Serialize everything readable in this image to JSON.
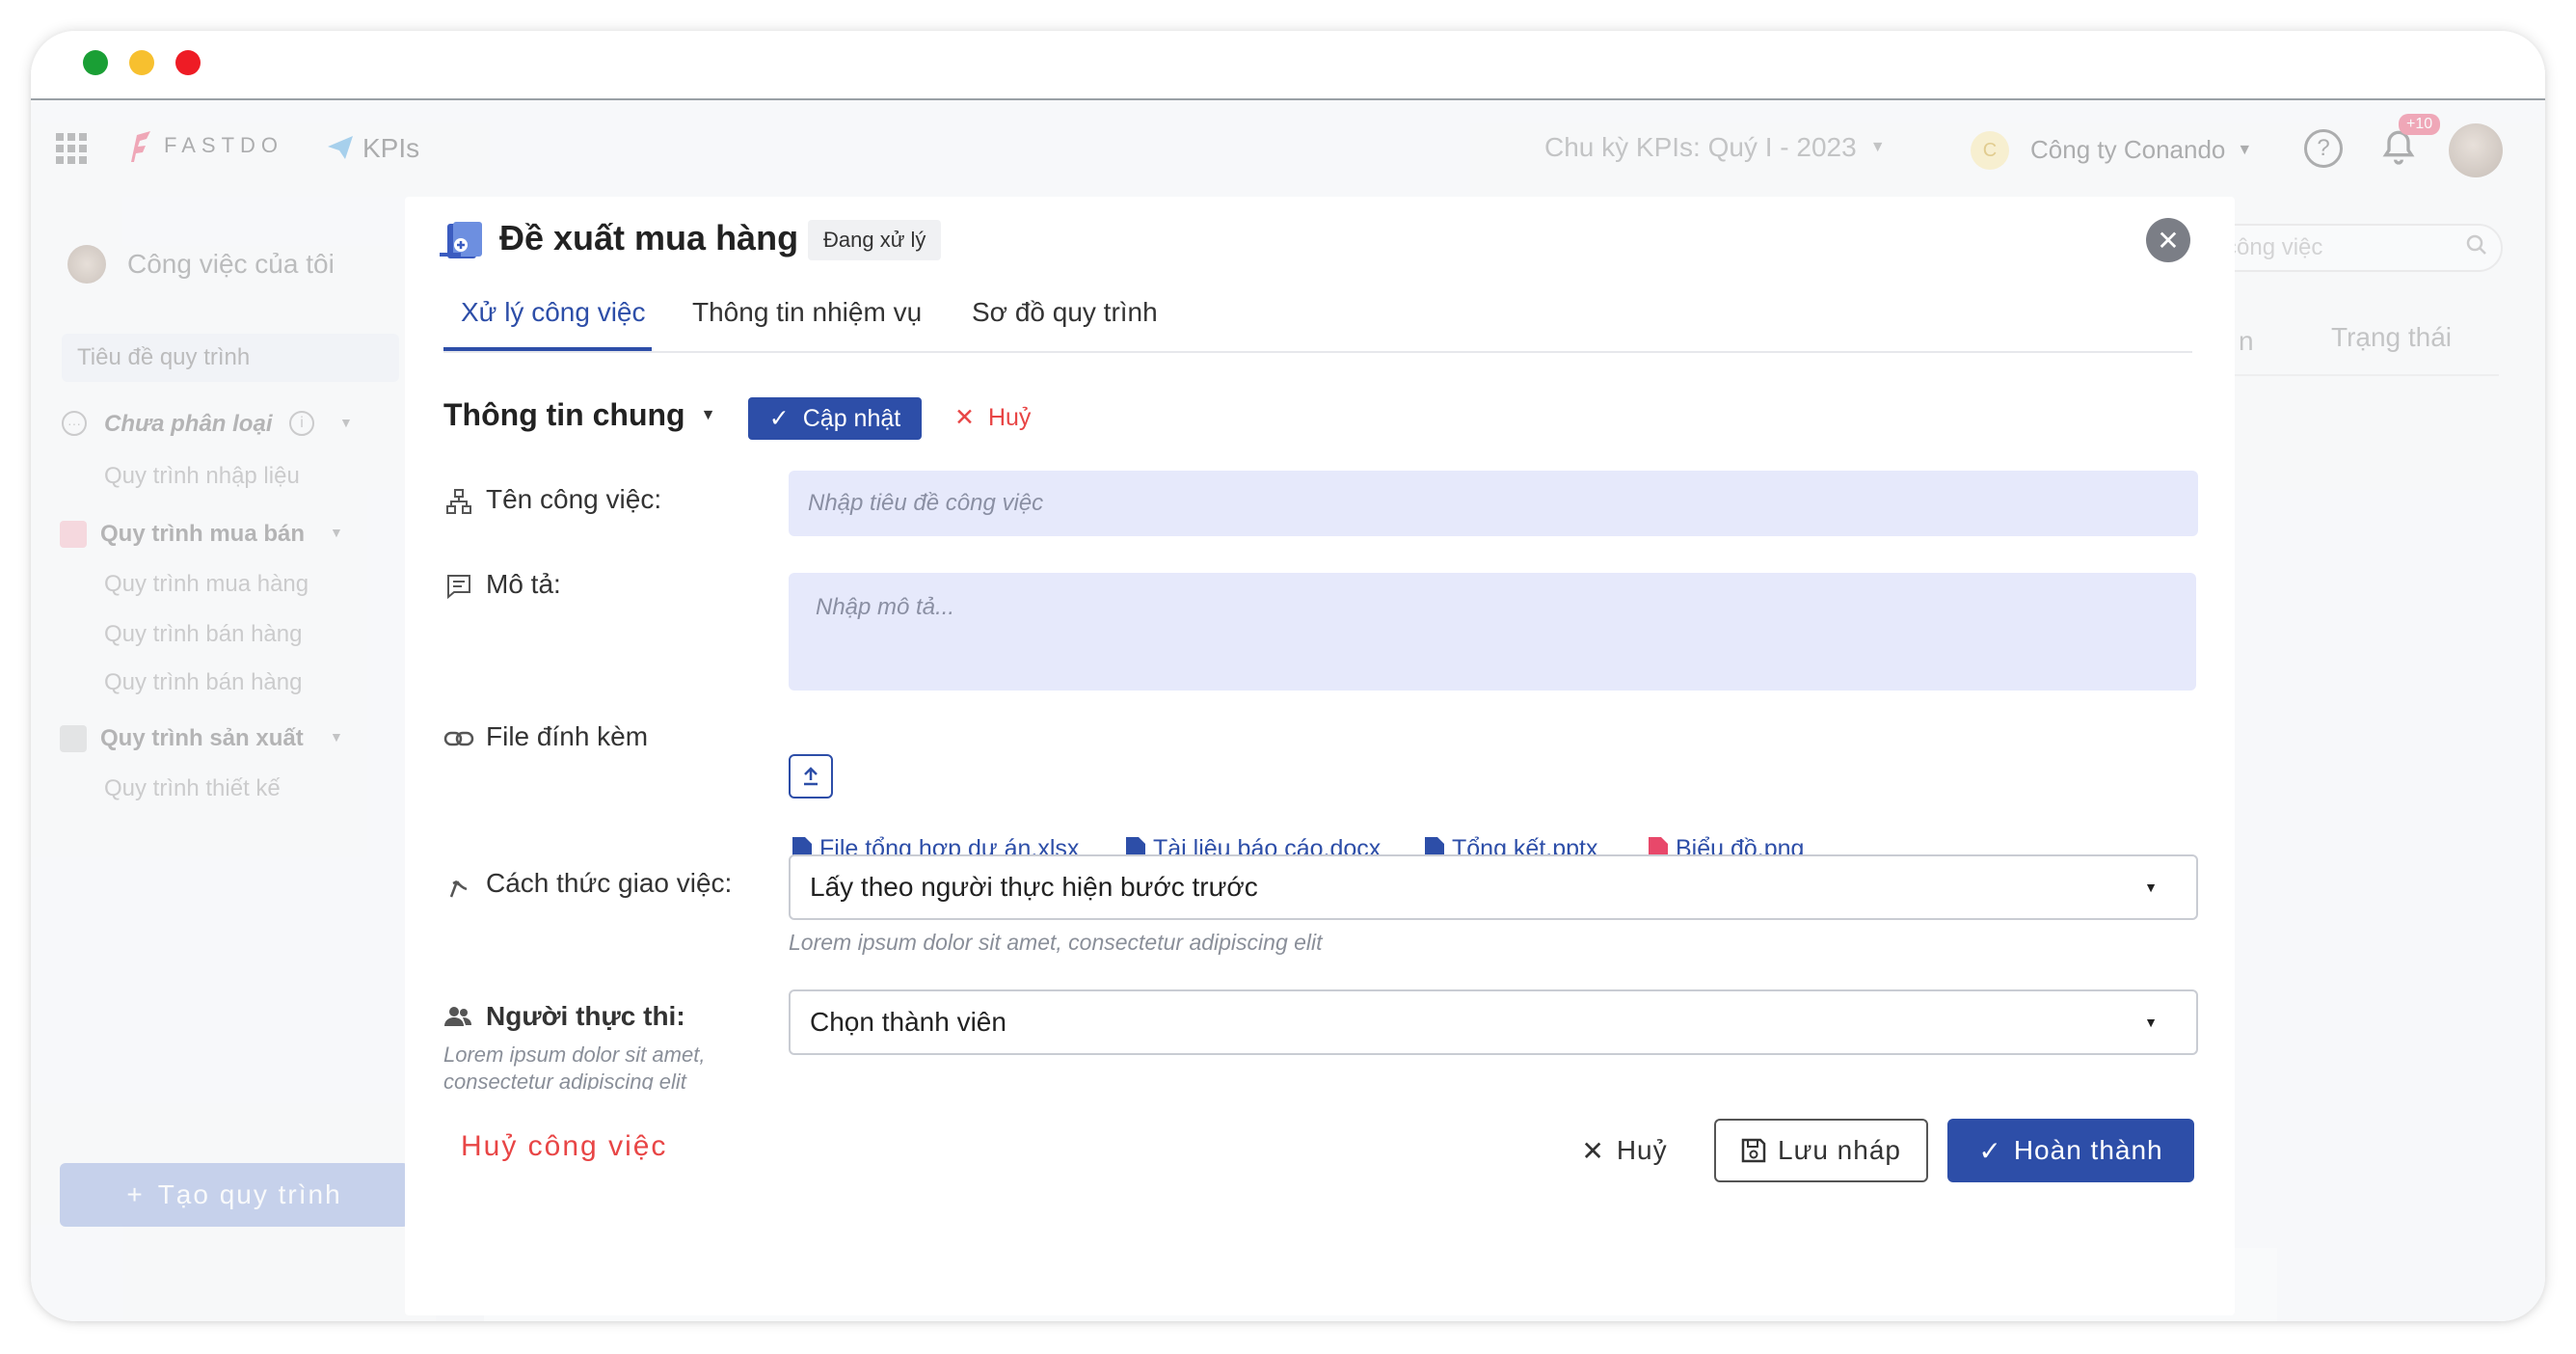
{
  "window": {
    "controls": [
      "close",
      "minimize",
      "maximize"
    ]
  },
  "nav": {
    "brand": "FASTDO",
    "module": "KPIs",
    "cycle": "Chu kỳ KPIs: Quý I - 2023",
    "company_initial": "C",
    "company": "Công ty Conando",
    "notification_count": "+10"
  },
  "sidebar": {
    "title": "Công việc của tôi",
    "search_placeholder": "Tiêu đề quy trình",
    "groups": [
      {
        "label": "Chưa phân loại",
        "items": [
          "Quy trình nhập liệu"
        ]
      },
      {
        "label": "Quy trình mua bán",
        "items": [
          "Quy trình mua hàng",
          "Quy trình bán hàng",
          "Quy trình bán hàng"
        ]
      },
      {
        "label": "Quy trình sản xuất",
        "items": [
          "Quy trình thiết kế"
        ]
      }
    ],
    "create_button": "Tạo quy trình"
  },
  "right_panel": {
    "search_placeholder": "công việc",
    "column_partial": "n",
    "column_status": "Trạng thái"
  },
  "modal": {
    "title": "Đề xuất mua hàng",
    "status_badge": "Đang xử lý",
    "tabs": [
      "Xử lý công việc",
      "Thông tin nhiệm vụ",
      "Sơ đồ quy trình"
    ],
    "active_tab": 0,
    "section_title": "Thông tin chung",
    "update_button": "Cập nhật",
    "cancel_inline": "Huỷ",
    "fields": {
      "task_name": {
        "label": "Tên công việc:",
        "placeholder": "Nhập tiêu đề công việc"
      },
      "description": {
        "label": "Mô tả:",
        "placeholder": "Nhập mô tả..."
      },
      "attachment": {
        "label": "File đính kèm",
        "files": [
          {
            "name": "File tổng hợp dự án.xlsx",
            "color": "#2d4ea8"
          },
          {
            "name": "Tài liệu báo cáo.docx",
            "color": "#2d4ea8"
          },
          {
            "name": "Tổng kết.pptx",
            "color": "#2d4ea8"
          },
          {
            "name": "Biểu đồ.png",
            "color": "#e8486a"
          }
        ]
      },
      "assign_method": {
        "label": "Cách thức giao việc:",
        "value": "Lấy theo người thực hiện bước trước",
        "hint": "Lorem ipsum dolor sit amet, consectetur adipiscing elit"
      },
      "executor": {
        "label": "Người thực thi:",
        "hint": "Lorem ipsum dolor sit amet, consectetur adipiscing elit",
        "value": "Chọn thành viên"
      }
    },
    "footer": {
      "cancel_task": "Huỷ công việc",
      "cancel": "Huỷ",
      "save_draft": "Lưu nháp",
      "complete": "Hoàn thành"
    }
  },
  "colors": {
    "primary": "#2d4ea8",
    "danger": "#e84545",
    "field_bg": "#e6e9fb"
  }
}
